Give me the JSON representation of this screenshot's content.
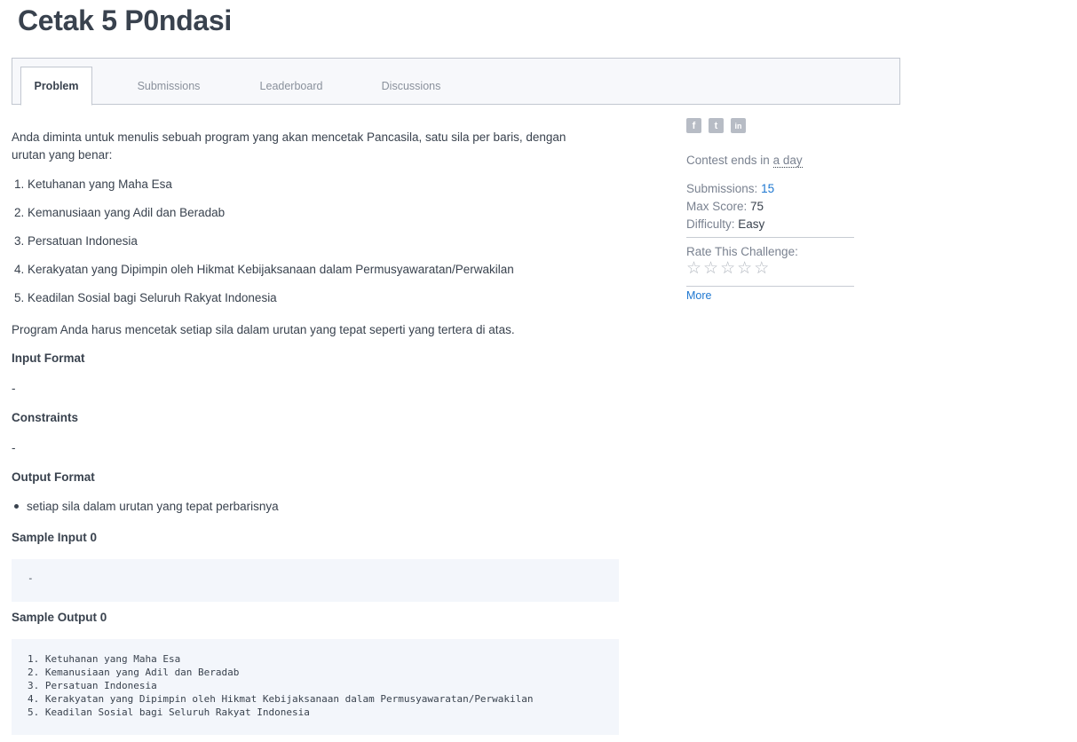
{
  "page": {
    "title": "Cetak 5 P0ndasi"
  },
  "tabs": [
    {
      "label": "Problem",
      "active": true
    },
    {
      "label": "Submissions",
      "active": false
    },
    {
      "label": "Leaderboard",
      "active": false
    },
    {
      "label": "Discussions",
      "active": false
    }
  ],
  "problem": {
    "intro_line1": "Anda diminta untuk menulis sebuah program yang akan mencetak Pancasila, satu sila per baris, dengan",
    "intro_line2": "urutan yang benar:",
    "items": [
      "1. Ketuhanan yang Maha Esa",
      "2. Kemanusiaan yang Adil dan Beradab",
      "3. Persatuan Indonesia",
      "4. Kerakyatan yang Dipimpin oleh Hikmat Kebijaksanaan dalam Permusyawaratan/Perwakilan",
      "5. Keadilan Sosial bagi Seluruh Rakyat Indonesia"
    ],
    "closing": "Program Anda harus mencetak setiap sila dalam urutan yang tepat seperti yang tertera di atas.",
    "input_format_heading": "Input Format",
    "input_format_text": "-",
    "constraints_heading": "Constraints",
    "constraints_text": "-",
    "output_format_heading": "Output Format",
    "output_format_bullet": "setiap sila dalam urutan yang tepat perbarisnya",
    "sample_input_heading": "Sample Input 0",
    "sample_input_code": "-",
    "sample_output_heading": "Sample Output 0",
    "sample_output_lines": [
      "1. Ketuhanan yang Maha Esa",
      "2. Kemanusiaan yang Adil dan Beradab",
      "3. Persatuan Indonesia",
      "4. Kerakyatan yang Dipimpin oleh Hikmat Kebijaksanaan dalam Permusyawaratan/Perwakilan",
      "5. Keadilan Sosial bagi Seluruh Rakyat Indonesia"
    ]
  },
  "sidebar": {
    "share_icons": [
      {
        "name": "facebook-icon",
        "glyph": "f"
      },
      {
        "name": "twitter-icon",
        "glyph": "t"
      },
      {
        "name": "linkedin-icon",
        "glyph": "in"
      }
    ],
    "contest_prefix": "Contest ends in",
    "contest_value": "a day",
    "submissions_label": "Submissions:",
    "submissions_value": "15",
    "max_score_label": "Max Score:",
    "max_score_value": "75",
    "difficulty_label": "Difficulty:",
    "difficulty_value": "Easy",
    "rate_label": "Rate This Challenge:",
    "star_glyph": "☆",
    "more_label": "More"
  },
  "colors": {
    "link": "#1f78d1",
    "text": "#39424e",
    "muted": "#7a8290",
    "code_bg": "#f3f6fb"
  }
}
